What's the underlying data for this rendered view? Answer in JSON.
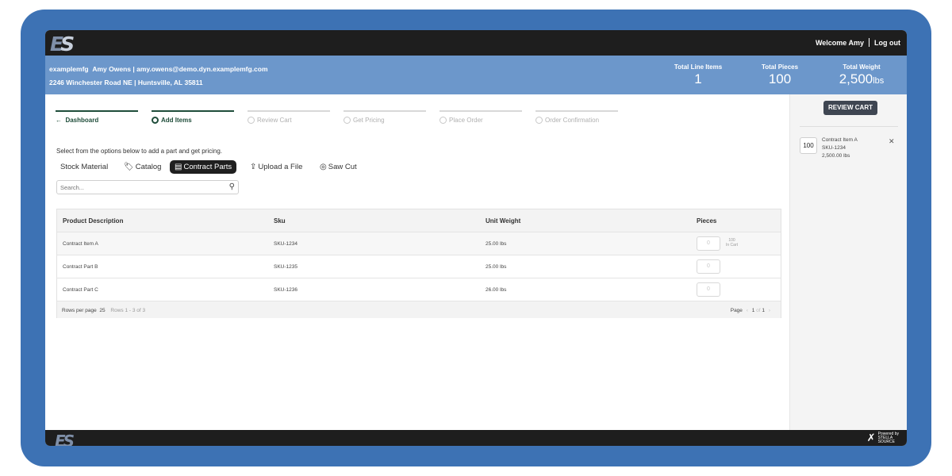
{
  "topbar": {
    "logo_text_e": "E",
    "logo_text_s": "S",
    "welcome": "Welcome Amy",
    "logout": "Log out"
  },
  "account": {
    "company": "examplemfg",
    "name": "Amy Owens",
    "email": "amy.owens@demo.dyn.examplemfg.com",
    "address": "2246 Winchester Road NE | Huntsville, AL 35811",
    "stats": [
      {
        "label": "Total Line Items",
        "value": "1",
        "unit": ""
      },
      {
        "label": "Total Pieces",
        "value": "100",
        "unit": ""
      },
      {
        "label": "Total Weight",
        "value": "2,500",
        "unit": "lbs"
      }
    ]
  },
  "steps": [
    {
      "label": "Dashboard",
      "state": "done"
    },
    {
      "label": "Add Items",
      "state": "active"
    },
    {
      "label": "Review Cart",
      "state": "pending"
    },
    {
      "label": "Get Pricing",
      "state": "pending"
    },
    {
      "label": "Place Order",
      "state": "pending"
    },
    {
      "label": "Order Confirmation",
      "state": "pending"
    }
  ],
  "intro": "Select from the options below to add a part and get pricing.",
  "tabs": [
    {
      "label": "Stock Material",
      "icon": ""
    },
    {
      "label": "Catalog",
      "icon": "tag-icon"
    },
    {
      "label": "Contract Parts",
      "icon": "store-icon",
      "active": true
    },
    {
      "label": "Upload a File",
      "icon": "upload-icon"
    },
    {
      "label": "Saw Cut",
      "icon": "saw-icon"
    }
  ],
  "search": {
    "placeholder": "Search..."
  },
  "table": {
    "headers": [
      "Product Description",
      "Sku",
      "Unit Weight",
      "Pieces"
    ],
    "rows": [
      {
        "description": "Contract Item A",
        "sku": "SKU-1234",
        "weight": "25.00 lbs",
        "pieces": "0",
        "in_cart_qty": "100",
        "in_cart_label": "In Cart"
      },
      {
        "description": "Contract Part B",
        "sku": "SKU-1235",
        "weight": "25.00 lbs",
        "pieces": "0"
      },
      {
        "description": "Contract Part C",
        "sku": "SKU-1236",
        "weight": "26.00 lbs",
        "pieces": "0"
      }
    ],
    "footer": {
      "rows_per_page_label": "Rows per page",
      "rows_per_page": "25",
      "rows_summary": "Rows 1 - 3 of 3",
      "page_label": "Page",
      "page": "1",
      "of_label": "of",
      "total_pages": "1"
    }
  },
  "cart": {
    "review_button": "REVIEW CART",
    "items": [
      {
        "qty": "100",
        "name": "Contract Item A",
        "sku": "SKU-1234",
        "weight": "2,500.00 lbs"
      }
    ]
  },
  "footer": {
    "logo_text": "ES",
    "powered_by": "Powered by",
    "brand_1": "STELLA",
    "brand_2": "SOURCE"
  }
}
